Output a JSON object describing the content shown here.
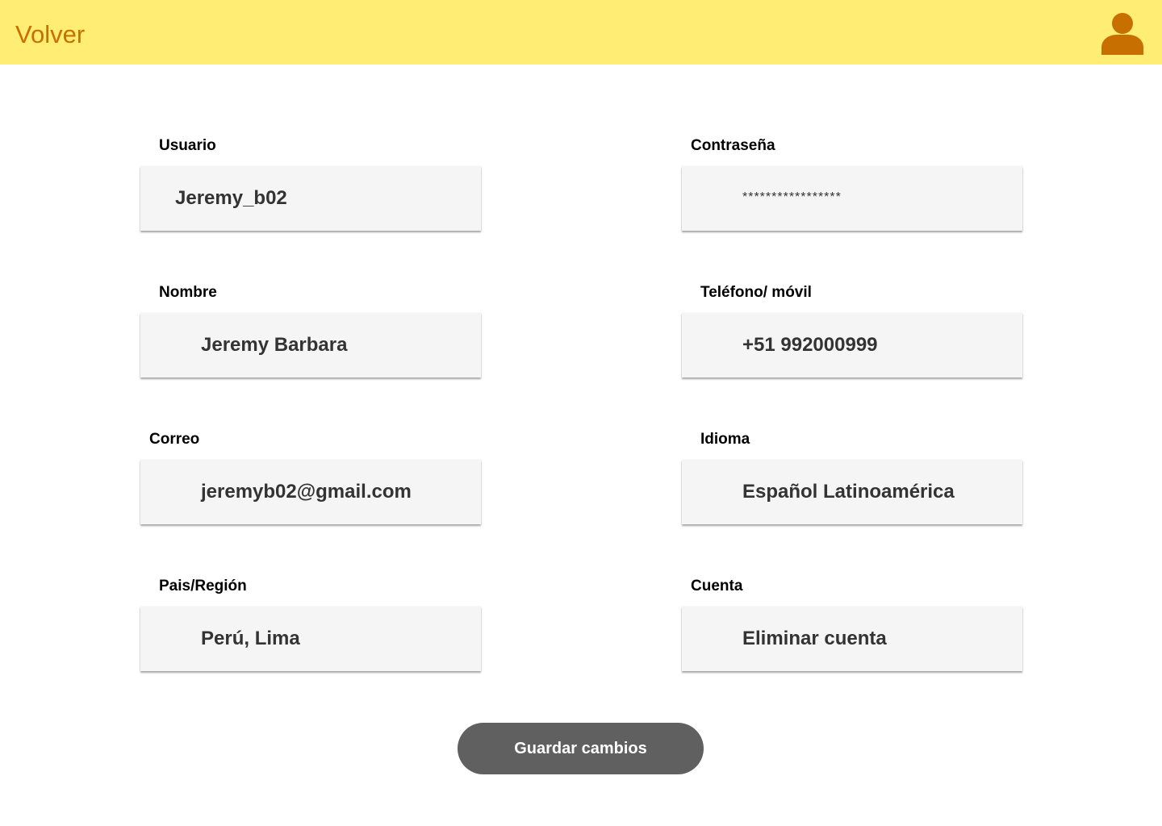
{
  "header": {
    "back_label": "Volver",
    "avatar_icon": "user-icon",
    "background_color": "#FFEE73",
    "accent_color": "#C76F00"
  },
  "form": {
    "fields": [
      {
        "id": "usuario",
        "label": "Usuario",
        "value": "Jeremy_b02"
      },
      {
        "id": "contrasena",
        "label": "Contraseña",
        "value": "*****************"
      },
      {
        "id": "nombre",
        "label": "Nombre",
        "value": "Jeremy Barbara"
      },
      {
        "id": "telefono",
        "label": "Teléfono/ móvil",
        "value": "+51 992000999"
      },
      {
        "id": "correo",
        "label": "Correo",
        "value": "jeremyb02@gmail.com"
      },
      {
        "id": "idioma",
        "label": "Idioma",
        "value": "Español Latinoamérica"
      },
      {
        "id": "pais",
        "label": "Pais/Región",
        "value": "Perú, Lima"
      },
      {
        "id": "cuenta",
        "label": "Cuenta",
        "value": "Eliminar cuenta"
      }
    ],
    "save_label": "Guardar cambios",
    "save_button_color": "#606060"
  }
}
